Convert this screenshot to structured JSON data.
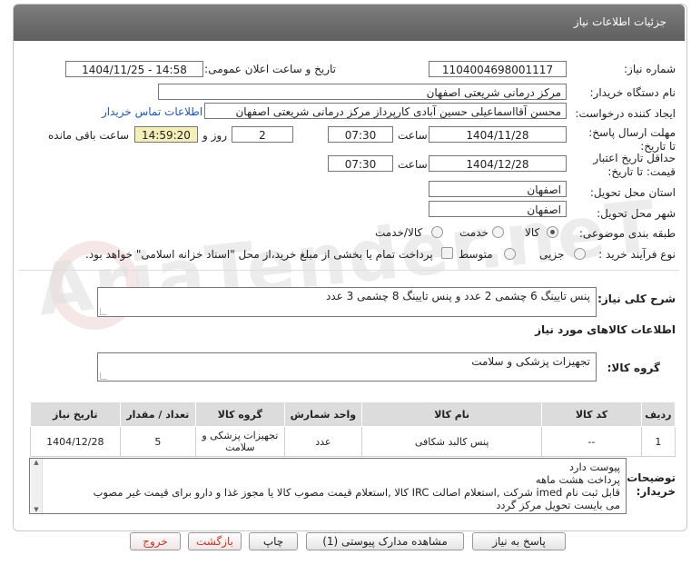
{
  "header": {
    "title": "جزئیات اطلاعات نیاز"
  },
  "watermark": {
    "text": "AriaTender.neT"
  },
  "fields": {
    "need_number_label": "شماره نیاز:",
    "need_number": "1104004698001117",
    "announce_label": "تاریخ و ساعت اعلان عمومی:",
    "announce_value": "1404/11/25 - 14:58",
    "buyer_org_label": "نام دستگاه خریدار:",
    "buyer_org": "مرکز درمانی شریعتی اصفهان",
    "creator_label": "ایجاد کننده درخواست:",
    "creator": "محسن آقااسماعیلی حسین آبادی کارپرداز مرکز درمانی شریعتی اصفهان",
    "contact_link": "اطلاعات تماس خریدار",
    "deadline_label": "مهلت ارسال پاسخ: تا تاریخ:",
    "deadline_date": "1404/11/28",
    "time_word": "ساعت",
    "deadline_time": "07:30",
    "days_value": "2",
    "days_word": "روز و",
    "remaining_time": "14:59:20",
    "remaining_word": "ساعت باقی مانده",
    "validity_label": "حداقل تاریخ اعتبار قیمت: تا تاریخ:",
    "validity_date": "1404/12/28",
    "validity_time": "07:30",
    "province_label": "استان محل تحویل:",
    "province": "اصفهان",
    "city_label": "شهر محل تحویل:",
    "city": "اصفهان",
    "category_label": "طبقه بندی موضوعی:",
    "category_options": [
      "کالا",
      "خدمت",
      "کالا/خدمت"
    ],
    "process_label": "نوع فرآیند خرید :",
    "process_options": [
      "جزیی",
      "متوسط"
    ],
    "payment_note": "پرداخت تمام یا بخشی از مبلغ خرید،از محل \"اسناد خزانه اسلامی\" خواهد بود."
  },
  "summary": {
    "label": "شرح کلی نیاز:",
    "text": "پنس تایینگ 6 چشمی 2 عدد و پنس تایینگ 8 چشمی 3 عدد"
  },
  "goods": {
    "section_title": "اطلاعات کالاهای مورد نیاز",
    "group_label": "گروه کالا:",
    "group_value": "تجهیزات پزشکی و سلامت",
    "columns": [
      "ردیف",
      "کد کالا",
      "نام کالا",
      "واحد شمارش",
      "گروه کالا",
      "تعداد / مقدار",
      "تاریخ نیاز"
    ],
    "rows": [
      [
        "1",
        "--",
        "پنس کالبد شکافی",
        "عدد",
        "تجهیزات پزشکی و سلامت",
        "5",
        "1404/12/28"
      ]
    ]
  },
  "buyer_notes": {
    "label": "توضیحات خریدار:",
    "lines": [
      "پیوست دارد",
      "پرداخت هشت ماهه",
      "قابل ثبت نام imed شرکت ,استعلام اصالت IRC کالا ,استعلام قیمت مصوب کالا یا مجوز غذا و دارو برای قیمت غیر مصوب",
      "می بایست تحویل مرکز گردد"
    ]
  },
  "buttons": {
    "reply": "پاسخ به نیاز",
    "attachments": "مشاهده مدارک پیوستی (1)",
    "print": "چاپ",
    "back": "بازگشت",
    "exit": "خروج"
  }
}
